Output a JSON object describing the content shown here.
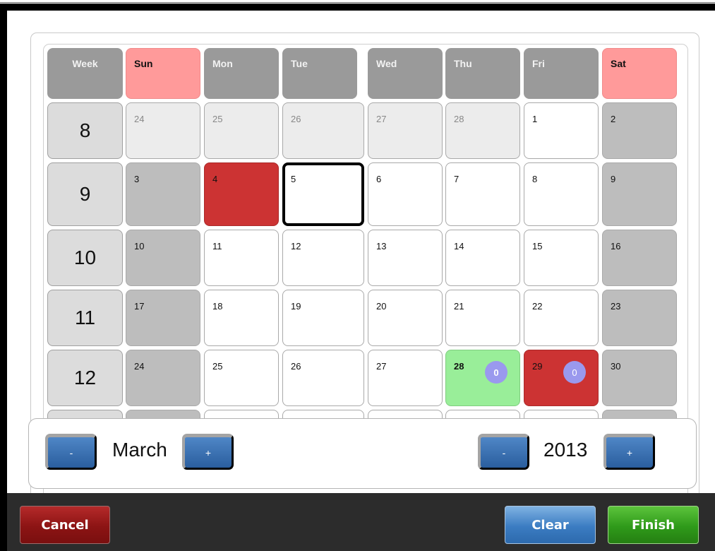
{
  "headers": {
    "week": "Week",
    "days": [
      "Sun",
      "Mon",
      "Tue",
      "Wed",
      "Thu",
      "Fri",
      "Sat"
    ]
  },
  "rows": [
    {
      "week": "8",
      "days": [
        "24",
        "25",
        "26",
        "27",
        "28",
        "1",
        "2"
      ]
    },
    {
      "week": "9",
      "days": [
        "3",
        "4",
        "5",
        "6",
        "7",
        "8",
        "9"
      ]
    },
    {
      "week": "10",
      "days": [
        "10",
        "11",
        "12",
        "13",
        "14",
        "15",
        "16"
      ]
    },
    {
      "week": "11",
      "days": [
        "17",
        "18",
        "19",
        "20",
        "21",
        "22",
        "23"
      ]
    },
    {
      "week": "12",
      "days": [
        "24",
        "25",
        "26",
        "27",
        "28",
        "29",
        "30"
      ]
    }
  ],
  "badges": {
    "thu_28": "0",
    "fri_29": "0"
  },
  "month_nav": {
    "minus": "-",
    "label": "March",
    "plus": "+"
  },
  "year_nav": {
    "minus": "-",
    "label": "2013",
    "plus": "+"
  },
  "buttons": {
    "cancel": "Cancel",
    "clear": "Clear",
    "finish": "Finish"
  },
  "colors": {
    "header": "#9a9a9a",
    "weekend_header": "#ff9a9a",
    "weekend_day": "#bdbdbd",
    "other_month": "#ececec",
    "marked_red": "#cc3333",
    "marked_green": "#99ee99",
    "badge": "#9a99ee",
    "cancel": "#8c1414",
    "clear": "#3b7cc2",
    "finish": "#2f9a1a"
  }
}
